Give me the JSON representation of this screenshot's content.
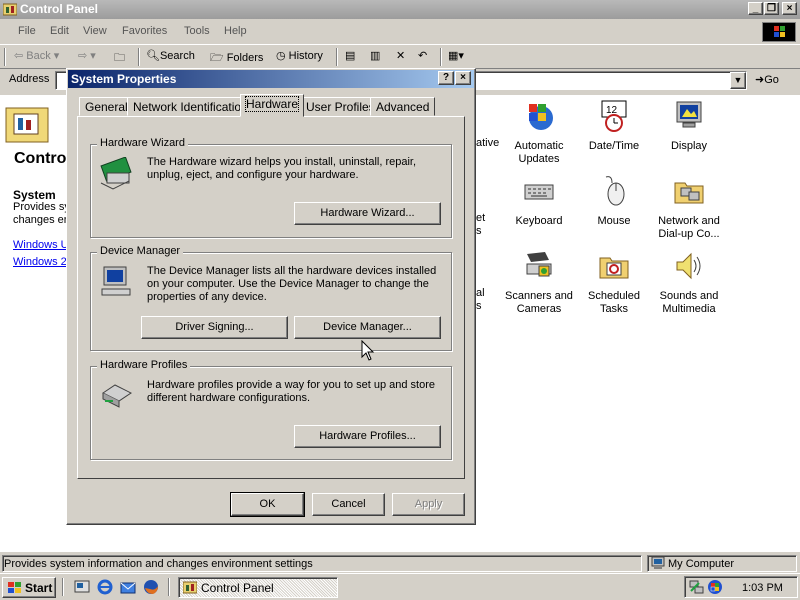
{
  "window": {
    "title": "Control Panel"
  },
  "menu": [
    "File",
    "Edit",
    "View",
    "Favorites",
    "Tools",
    "Help"
  ],
  "toolbar": {
    "back": "Back",
    "search": "Search",
    "folders": "Folders",
    "history": "History"
  },
  "address": {
    "label": "Address",
    "go": "Go"
  },
  "left_pane": {
    "title": "Contro",
    "section": "System",
    "desc_line1": "Provides sy",
    "desc_line2": "changes en",
    "links": [
      "Windows U",
      "Windows 2"
    ]
  },
  "items": [
    {
      "name": "Automatic Updates",
      "icon": "windows-update-icon"
    },
    {
      "name": "Date/Time",
      "icon": "clock-icon"
    },
    {
      "name": "Display",
      "icon": "monitor-icon"
    },
    {
      "name": "Keyboard",
      "icon": "keyboard-icon"
    },
    {
      "name": "Mouse",
      "icon": "mouse-icon"
    },
    {
      "name": "Network and Dial-up Co...",
      "icon": "network-folder-icon"
    },
    {
      "name": "Scanners and Cameras",
      "icon": "scanner-icon"
    },
    {
      "name": "Scheduled Tasks",
      "icon": "scheduled-tasks-icon"
    },
    {
      "name": "Sounds and Multimedia",
      "icon": "speaker-icon"
    }
  ],
  "partial_items": [
    "ative",
    "et",
    "s",
    "al",
    "s"
  ],
  "dialog": {
    "title": "System Properties",
    "tabs": [
      "General",
      "Network Identification",
      "Hardware",
      "User Profiles",
      "Advanced"
    ],
    "active_tab": "Hardware",
    "hardware_wizard": {
      "label": "Hardware Wizard",
      "text": "The Hardware wizard helps you install, uninstall, repair, unplug, eject, and configure your hardware.",
      "button": "Hardware Wizard..."
    },
    "device_manager": {
      "label": "Device Manager",
      "text": "The Device Manager lists all the hardware devices installed on your computer. Use the Device Manager to change the properties of any device.",
      "driver_button": "Driver Signing...",
      "dm_button": "Device Manager..."
    },
    "hardware_profiles": {
      "label": "Hardware Profiles",
      "text": "Hardware profiles provide a way for you to set up and store different hardware configurations.",
      "button": "Hardware Profiles..."
    },
    "ok": "OK",
    "cancel": "Cancel",
    "apply": "Apply"
  },
  "status": {
    "text": "Provides system information and changes environment settings",
    "zone": "My Computer"
  },
  "taskbar": {
    "start": "Start",
    "task": "Control Panel",
    "clock": "1:03 PM"
  },
  "colors": {
    "dialog_title_start": "#0a246a",
    "dialog_title_end": "#a6caf0",
    "face": "#d4d0c8"
  }
}
